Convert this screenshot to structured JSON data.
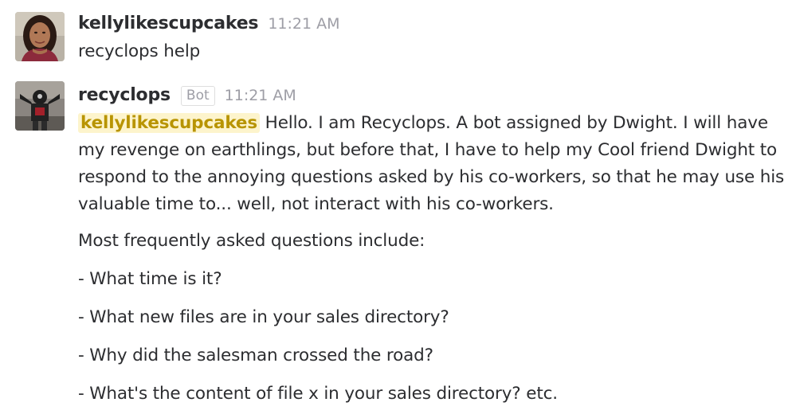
{
  "messages": [
    {
      "author": "kellylikescupcakes",
      "time": "11:21 AM",
      "avatar": "woman-portrait-avatar",
      "text": "recyclops help"
    },
    {
      "author": "recyclops",
      "badge": "Bot",
      "time": "11:21 AM",
      "avatar": "robot-costume-avatar",
      "mention": "kellylikescupcakes",
      "intro": " Hello. I am Recyclops. A bot assigned by Dwight. I will have my revenge on earthlings, but before that, I have to help my Cool friend Dwight to respond to the annoying questions asked by his co-workers, so that he may use his valuable time to... well, not interact with his co-workers.",
      "faq_heading": "Most frequently asked questions include:",
      "faq_items": [
        "- What time is it?",
        "- What new files are in your sales directory?",
        "- Why did the salesman crossed the road?",
        "- What's the content of file x in your sales directory? etc."
      ]
    }
  ],
  "colors": {
    "mention_bg": "#fdf4cc",
    "mention_text": "#b89400",
    "timestamp": "#9e9ea6",
    "text": "#2c2d30"
  }
}
